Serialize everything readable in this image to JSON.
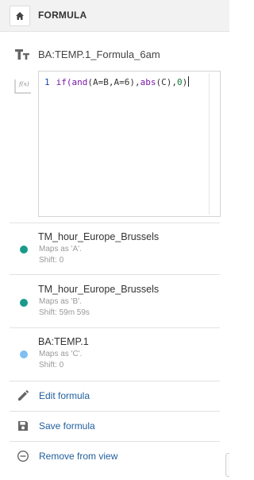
{
  "header": {
    "title": "FORMULA",
    "home_icon": "home-icon"
  },
  "formula": {
    "name": "BA:TEMP.1_Formula_6am",
    "name_icon": "text-type-icon",
    "editor_icon": "fx-icon",
    "line_number": "1",
    "code": {
      "t1": "if(",
      "t2": "and",
      "t3": "(A=B,A=6),",
      "t4": "abs",
      "t5": "(C),",
      "t6": "0",
      "t7": ")"
    }
  },
  "variables": [
    {
      "name": "TM_hour_Europe_Brussels",
      "maps": "Maps as 'A'.",
      "shift": "Shift: 0",
      "color": "#1a9a8a"
    },
    {
      "name": "TM_hour_Europe_Brussels",
      "maps": "Maps as 'B'.",
      "shift": "Shift: 59m 59s",
      "color": "#1a9a8a"
    },
    {
      "name": "BA:TEMP.1",
      "maps": "Maps as 'C'.",
      "shift": "Shift: 0",
      "color": "#7fbff2"
    }
  ],
  "actions": [
    {
      "label": "Edit formula",
      "icon": "pencil-icon"
    },
    {
      "label": "Save formula",
      "icon": "floppy-disk-icon"
    },
    {
      "label": "Remove from view",
      "icon": "remove-circle-icon"
    }
  ],
  "colors": {
    "link": "#1f5f9e",
    "keyword": "#7a1aa8",
    "line_number": "#1c3fa8",
    "number": "#117a3a"
  }
}
